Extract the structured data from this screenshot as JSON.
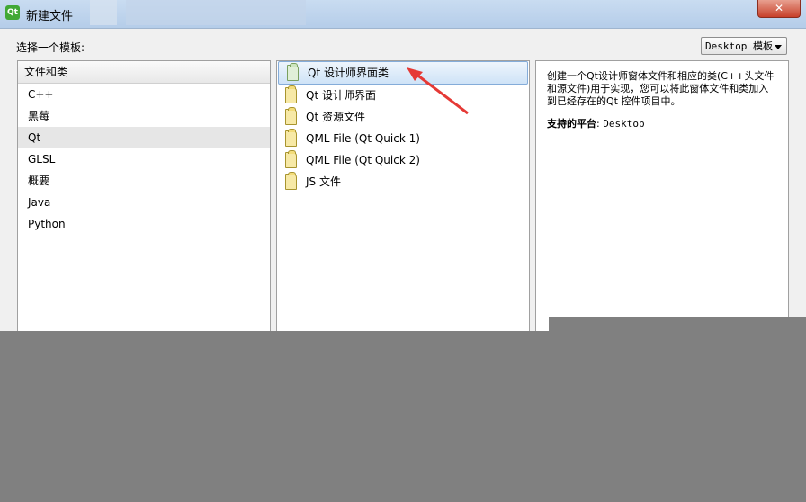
{
  "window": {
    "title": "新建文件",
    "app_icon": "Qt",
    "close": "✕"
  },
  "header": {
    "choose_label": "选择一个模板:",
    "filter": {
      "selected": "Desktop 模板"
    }
  },
  "categories": {
    "header": "文件和类",
    "items": [
      "C++",
      "黑莓",
      "Qt",
      "GLSL",
      "概要",
      "Java",
      "Python"
    ],
    "selected_index": 2
  },
  "templates": {
    "items": [
      "Qt 设计师界面类",
      "Qt 设计师界面",
      "Qt 资源文件",
      "QML File (Qt Quick 1)",
      "QML File (Qt Quick 2)",
      "JS 文件"
    ],
    "selected_index": 0
  },
  "description": {
    "text": "创建一个Qt设计师窗体文件和相应的类(C++头文件和源文件)用于实现，您可以将此窗体文件和类加入到已经存在的Qt 控件项目中。",
    "platform_label": "支持的平台",
    "platform_value": "Desktop"
  },
  "annotation": {
    "arrow_color": "#e53935"
  }
}
